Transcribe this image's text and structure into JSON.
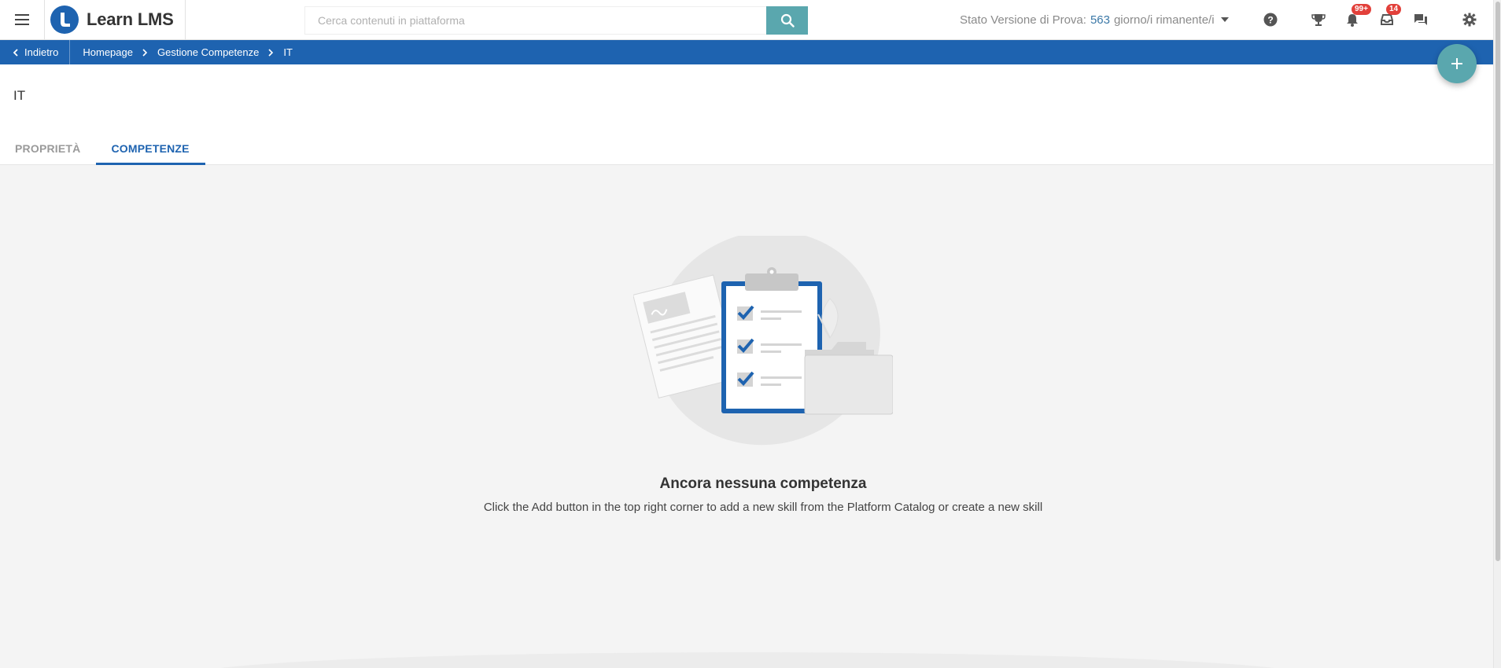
{
  "header": {
    "menu_icon": "hamburger-menu-icon",
    "brand_name": "Learn LMS",
    "search": {
      "placeholder": "Cerca contenuti in piattaforma",
      "value": ""
    },
    "trial": {
      "prefix": "Stato Versione di Prova:",
      "days": "563",
      "suffix": "giorno/i rimanente/i"
    },
    "icons": [
      {
        "name": "help-icon"
      },
      {
        "name": "trophy-icon"
      },
      {
        "name": "notifications-icon",
        "badge": "99+"
      },
      {
        "name": "inbox-icon",
        "badge": "14"
      },
      {
        "name": "chat-icon"
      },
      {
        "name": "settings-icon"
      }
    ]
  },
  "breadcrumb": {
    "back_label": "Indietro",
    "items": [
      "Homepage",
      "Gestione Competenze",
      "IT"
    ]
  },
  "page": {
    "title": "IT",
    "tabs": [
      {
        "label": "PROPRIETÀ",
        "active": false
      },
      {
        "label": "COMPETENZE",
        "active": true
      }
    ]
  },
  "empty_state": {
    "title": "Ancora nessuna competenza",
    "subtitle": "Click the Add button in the top right corner to add a new skill from the Platform Catalog or create a new skill"
  },
  "fab": {
    "icon": "plus-icon"
  },
  "colors": {
    "primary": "#1e63b0",
    "accent": "#5aa7ae",
    "badge": "#e2403a"
  }
}
